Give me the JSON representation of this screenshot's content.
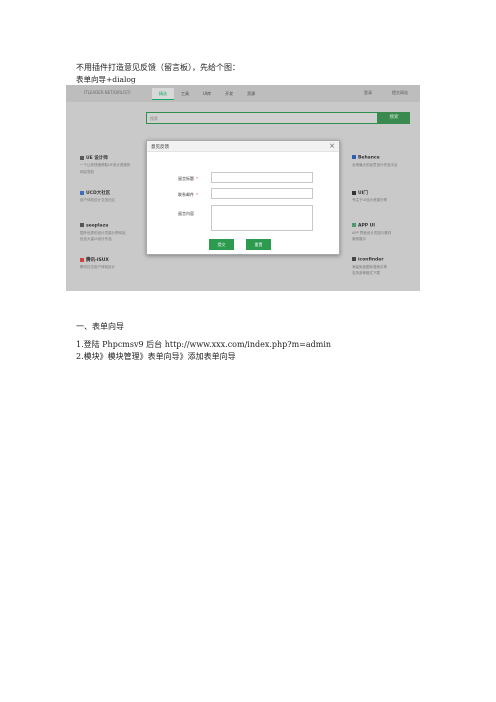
{
  "doc": {
    "intro": "不用插件打造意见反馈（留言板），先给个图：",
    "subtitle": "表单向导+dialog",
    "section_heading": "一、表单向导",
    "steps": [
      "1.登陆 Phpcmsv9 后台 http://www.xxx.com/index.php?m=admin",
      "2.模块》模块管理》表单向导》添加表单向导"
    ]
  },
  "screenshot": {
    "url_text": "ITLEADER.NET/DIRLIST/",
    "tabs": [
      "精选",
      "工具",
      "UI库",
      "开发",
      "资源"
    ],
    "active_tab_index": 0,
    "top_right": [
      "登录",
      "提交网站"
    ],
    "search_placeholder": "搜索",
    "search_button": "搜索",
    "items": [
      {
        "title": "UE 设计师",
        "desc1": "一个让你快速获取UE设计资源的",
        "desc2": "网站导航"
      },
      {
        "title": "UCD大社区",
        "desc1": "用户体验设计交流社区",
        "desc2": ""
      },
      {
        "title": "seeplaza",
        "desc1": "国外优秀的设计灵感分享网站",
        "desc2": "包含大量UI设计作品"
      },
      {
        "title": "腾讯-ISUX",
        "desc1": "腾讯社交用户体验设计",
        "desc2": ""
      },
      {
        "title": "Behance",
        "desc1": "全球最大的创意设计作品平台",
        "desc2": ""
      },
      {
        "title": "UI门",
        "desc1": "专注于UI设计资源分享",
        "desc2": ""
      },
      {
        "title": "APP UI",
        "desc1": "APP 界面设计灵感与素材",
        "desc2": "案例展示"
      },
      {
        "title": "iconfinder",
        "desc1": "海量免费图标搜索引擎",
        "desc2": "支持多种格式下载"
      }
    ]
  },
  "dialog": {
    "title": "意见反馈",
    "close_glyph": "×",
    "fields": [
      {
        "label": "留言标题",
        "required": "*"
      },
      {
        "label": "联系邮件",
        "required": "*"
      },
      {
        "label": "留言内容",
        "required": ""
      }
    ],
    "buttons": [
      "提交",
      "重置"
    ]
  },
  "colors": {
    "accent_green": "#2d9b4f",
    "overlay_gray": "#c9c9c9"
  }
}
